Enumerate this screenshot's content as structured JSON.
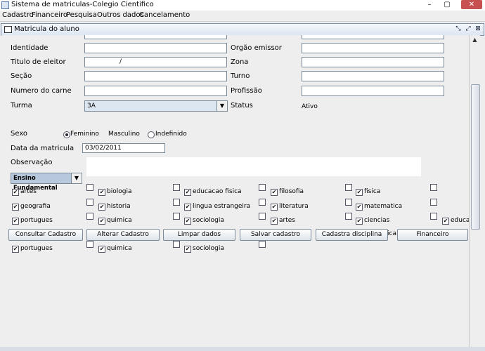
{
  "window": {
    "title": "Sistema de matriculas-Colegio Cientifico",
    "min": "–",
    "max": "▢",
    "close": "✕"
  },
  "menu": [
    "Cadastro",
    "Financeiro",
    "Pesquisa",
    "Outros dados",
    "Cancelamento"
  ],
  "frame": {
    "title": "Matricula do aluno",
    "btn_iconify": "⤡",
    "btn_restore": "⤢",
    "btn_close": "⊠"
  },
  "form": {
    "identidade": {
      "label": "Identidade",
      "value": ""
    },
    "orgao": {
      "label": "Orgão emissor",
      "value": ""
    },
    "titulo": {
      "label": "Titulo de eleitor",
      "value": "/"
    },
    "zona": {
      "label": "Zona",
      "value": ""
    },
    "secao": {
      "label": "Seção",
      "value": ""
    },
    "turno": {
      "label": "Turno",
      "value": ""
    },
    "carne": {
      "label": "Numero do carne",
      "value": ""
    },
    "profissao": {
      "label": "Profissão",
      "value": ""
    },
    "turma": {
      "label": "Turma",
      "value": "3A"
    },
    "status": {
      "label": "Status",
      "value": "Ativo"
    },
    "sexo": {
      "label": "Sexo",
      "options": [
        "Feminino",
        "Masculino",
        "Indefinido"
      ],
      "selected": "Feminino"
    },
    "data_matricula": {
      "label": "Data da matricula",
      "value": "03/02/2011"
    },
    "observacao": {
      "label": "Observação",
      "value": ""
    },
    "ensino": {
      "value": "Ensino Fundamental"
    }
  },
  "disciplinas": [
    [
      "artes",
      "biologia",
      "educacao fisica",
      "filosofia",
      "fisica"
    ],
    [
      "geografia",
      "historia",
      "lingua estrangeira",
      "literatura",
      "matematica"
    ],
    [
      "portugues",
      "quimica",
      "sociologia",
      "artes",
      "ciencias",
      "educac"
    ],
    [
      "portugues",
      "quimica",
      "sociologia"
    ]
  ],
  "buttons": [
    "Consultar Cadastro",
    "Alterar Cadastro",
    "Limpar dados",
    "Salvar cadastro",
    "Cadastra disciplina",
    "Financeiro"
  ],
  "overlap_text": "ica"
}
